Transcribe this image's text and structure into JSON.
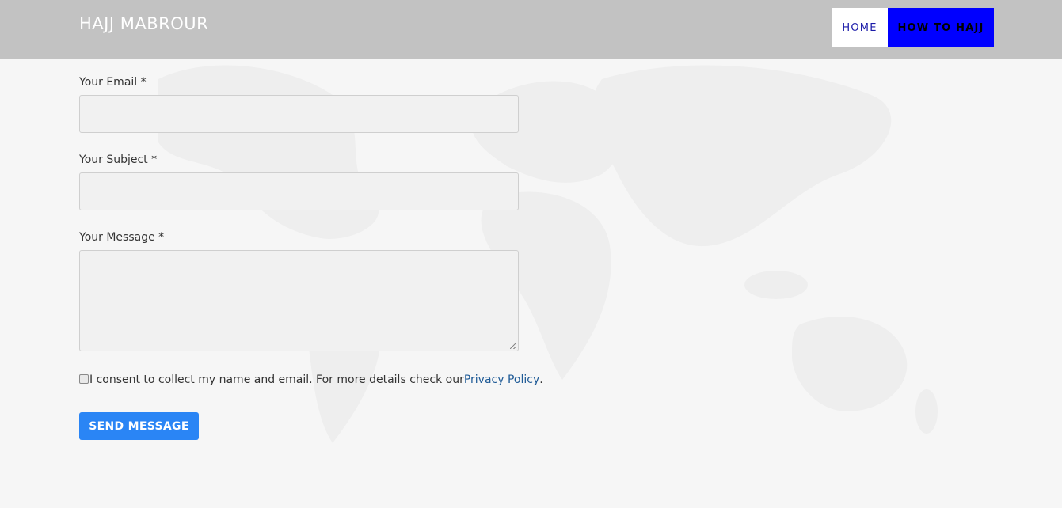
{
  "header": {
    "brand": "HAJJ MABROUR",
    "nav": [
      {
        "label": "HOME"
      },
      {
        "label": "HOW TO HAJJ"
      }
    ]
  },
  "form": {
    "email_label": "Your Email *",
    "email_value": "",
    "subject_label": "Your Subject *",
    "subject_value": "",
    "message_label": "Your Message *",
    "message_value": "",
    "consent_text": "I consent to collect my name and email. For more details check our ",
    "privacy_link": "Privacy Policy",
    "consent_end": ".",
    "consent_checked": false,
    "submit_label": "SEND MESSAGE"
  },
  "colors": {
    "header_bg": "#c2c2c2",
    "accent_button": "#2a85f5",
    "nav_active_bg": "#0000ff",
    "link": "#1e5a96"
  }
}
